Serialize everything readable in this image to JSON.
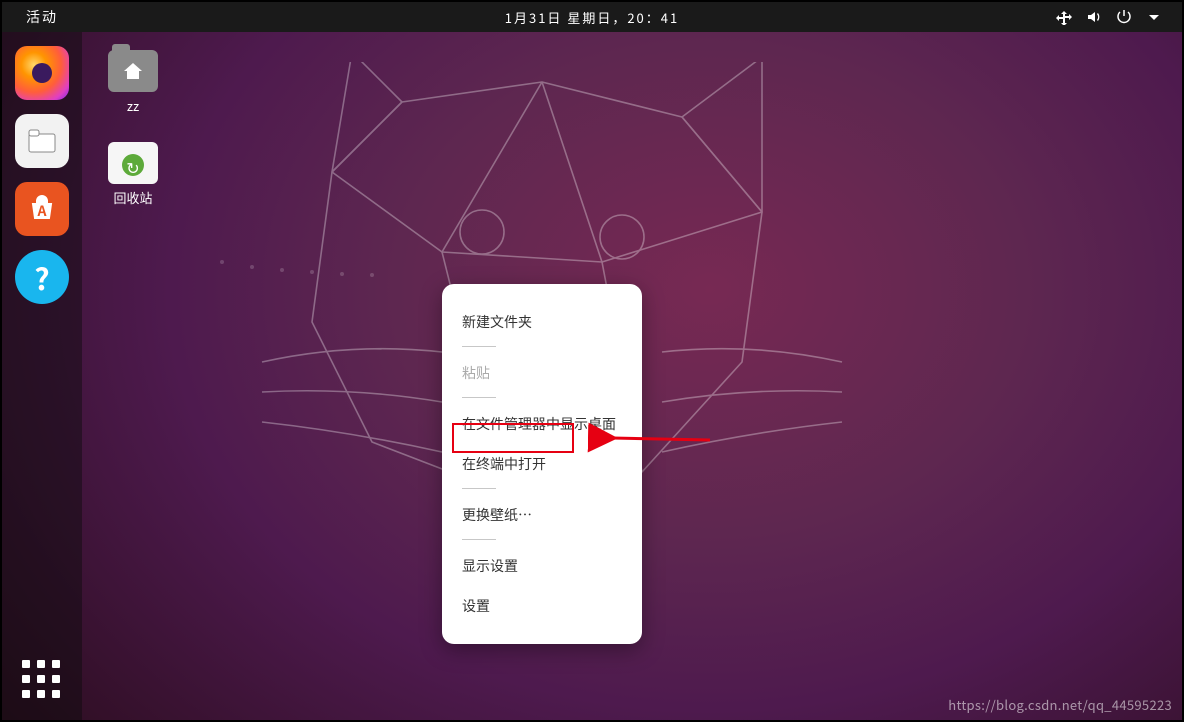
{
  "topbar": {
    "activities": "活动",
    "clock": "1月31日 星期日，20：41"
  },
  "desktop": {
    "home_folder": "zz",
    "trash": "回收站"
  },
  "context_menu": {
    "new_folder": "新建文件夹",
    "paste": "粘贴",
    "show_in_files": "在文件管理器中显示桌面",
    "open_terminal": "在终端中打开",
    "change_wallpaper": "更换壁纸…",
    "display_settings": "显示设置",
    "settings": "设置"
  },
  "watermark": "https://blog.csdn.net/qq_44595223"
}
